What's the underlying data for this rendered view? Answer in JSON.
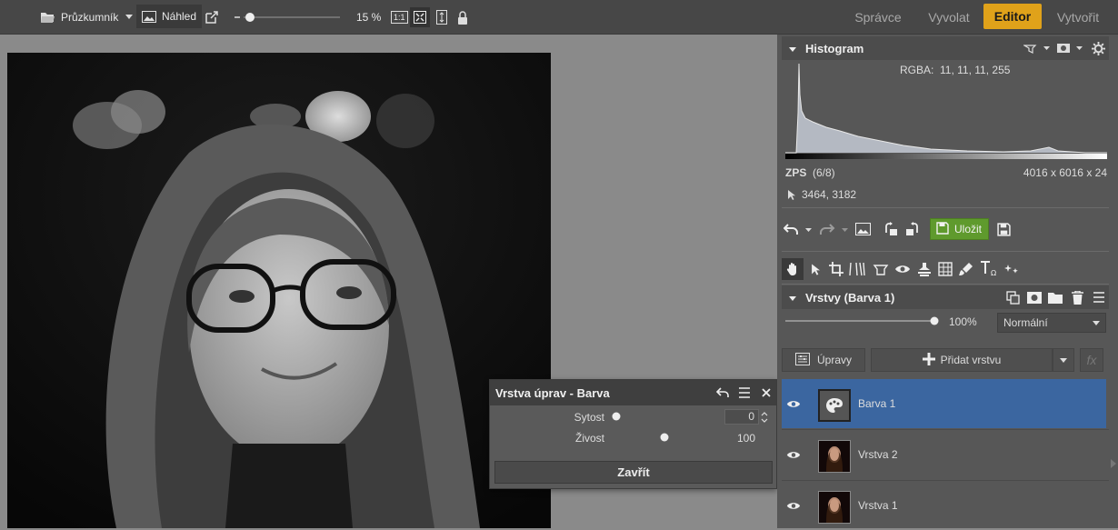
{
  "topbar": {
    "explorer_label": "Průzkumník",
    "preview_label": "Náhled",
    "zoom_value": 15,
    "zoom_label": "15 %",
    "fit_label": "1:1"
  },
  "nav": {
    "items": [
      "Správce",
      "Vyvolat",
      "Editor",
      "Vytvořit"
    ],
    "active": "Editor"
  },
  "histogram": {
    "title": "Histogram",
    "rgba_label": "RGBA:",
    "rgba_values": "11,  11,  11, 255",
    "zps_label": "ZPS",
    "zps_count": "(6/8)",
    "dimensions": "4016 x 6016 x 24",
    "cursor_position": "3464, 3182"
  },
  "toolbar": {
    "save_label": "Uložit"
  },
  "layers": {
    "title": "Vrstvy (Barva 1)",
    "opacity_value": 100,
    "opacity_label": "100%",
    "blend_mode": "Normální",
    "adjust_label": "Úpravy",
    "add_layer_label": "Přidat vrstvu",
    "fx_label": "fx",
    "items": [
      {
        "name": "Barva 1",
        "selected": true
      },
      {
        "name": "Vrstva 2",
        "selected": false
      },
      {
        "name": "Vrstva 1",
        "selected": false
      }
    ]
  },
  "dialog": {
    "title": "Vrstva úprav - Barva",
    "saturation_label": "Sytost",
    "saturation_value": "0",
    "vibrance_label": "Živost",
    "vibrance_value": "100",
    "close_label": "Zavřít"
  },
  "colors": {
    "accent": "#e0a21a",
    "save_green": "#5f9a2d",
    "selection_blue": "#3b66a0"
  }
}
